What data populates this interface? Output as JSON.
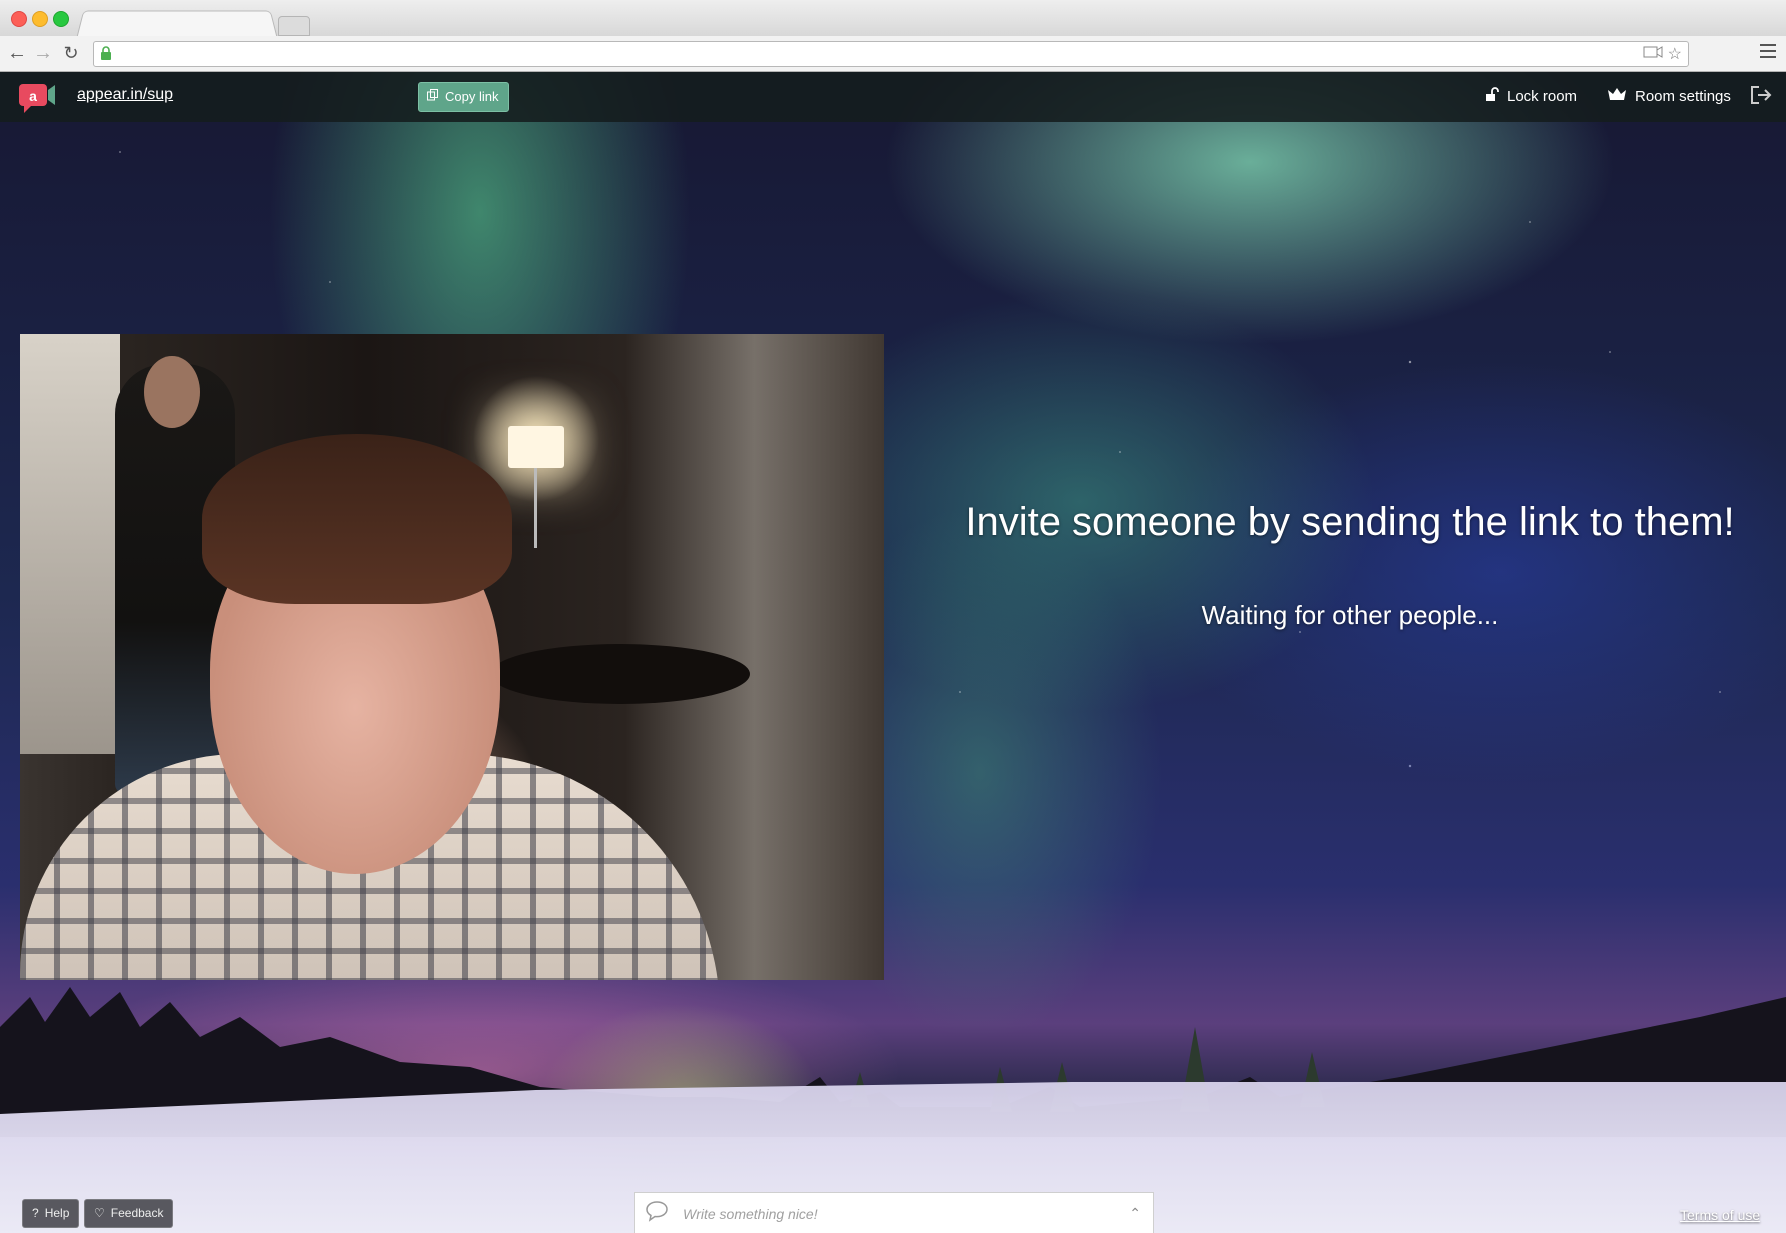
{
  "browser": {
    "address": "",
    "icons": [
      "back-icon",
      "forward-icon",
      "reload-icon",
      "lock-icon",
      "camera-icon",
      "star-icon",
      "menu-icon"
    ]
  },
  "header": {
    "room_link": "appear.in/sup",
    "copy_link": "Copy link",
    "lock_room": "Lock room",
    "room_settings": "Room settings"
  },
  "main": {
    "invite_text": "Invite someone by sending the link to them!",
    "waiting_text": "Waiting for other people..."
  },
  "footer": {
    "help": "Help",
    "feedback": "Feedback",
    "chat_placeholder": "Write something nice!",
    "terms": "Terms of use"
  },
  "colors": {
    "brand": "#e84a5f",
    "copy_button": "#5fa58a",
    "header_bg": "#141c1e"
  }
}
